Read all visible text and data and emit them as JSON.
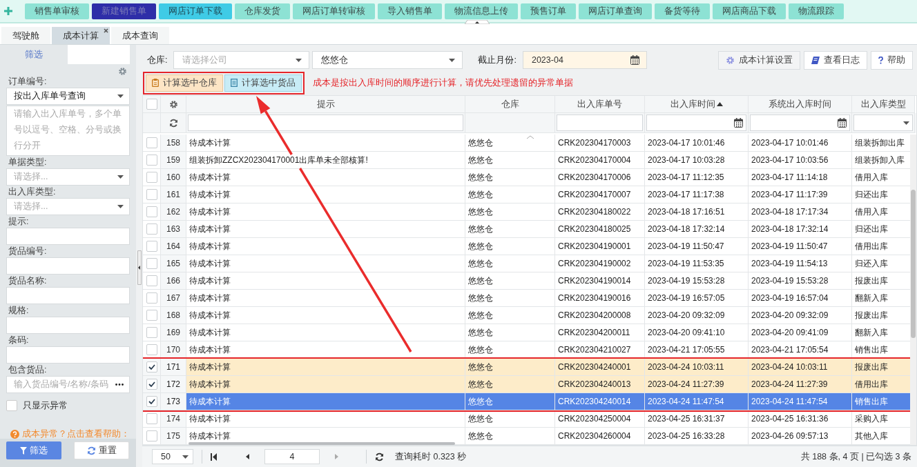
{
  "nav_buttons": [
    {
      "label": "销售单审核",
      "kind": "normal"
    },
    {
      "label": "新建销售单",
      "kind": "dark"
    },
    {
      "label": "网店订单下载",
      "kind": "active"
    },
    {
      "label": "仓库发货",
      "kind": "normal"
    },
    {
      "label": "网店订单转审核",
      "kind": "normal"
    },
    {
      "label": "导入销售单",
      "kind": "normal"
    },
    {
      "label": "物流信息上传",
      "kind": "normal"
    },
    {
      "label": "预售订单",
      "kind": "normal"
    },
    {
      "label": "网店订单查询",
      "kind": "normal"
    },
    {
      "label": "备货等待",
      "kind": "normal"
    },
    {
      "label": "网店商品下载",
      "kind": "normal"
    },
    {
      "label": "物流跟踪",
      "kind": "normal"
    }
  ],
  "tabs": [
    {
      "label": "驾驶舱",
      "selected": false,
      "closable": false
    },
    {
      "label": "成本计算",
      "selected": true,
      "closable": true
    },
    {
      "label": "成本查询",
      "selected": false,
      "closable": false
    }
  ],
  "sidebar": {
    "tab": "筛选",
    "fields": [
      {
        "label": "订单编号:",
        "kind": "select",
        "value": "按出入库单号查询"
      },
      {
        "kind": "textarea",
        "placeholder": "请输入出入库单号，多个单号以逗号、空格、分号或换行分开"
      },
      {
        "label": "单据类型:",
        "kind": "select",
        "placeholder": "请选择..."
      },
      {
        "label": "出入库类型:",
        "kind": "select",
        "placeholder": "请选择..."
      },
      {
        "label": "提示:",
        "kind": "text"
      },
      {
        "label": "货品编号:",
        "kind": "text"
      },
      {
        "label": "货品名称:",
        "kind": "text"
      },
      {
        "label": "规格:",
        "kind": "text"
      },
      {
        "label": "条码:",
        "kind": "text"
      },
      {
        "label": "包含货品:",
        "kind": "picker",
        "placeholder": "输入货品编号/名称/条码"
      }
    ],
    "only_abnormal": {
      "label": "只显示异常",
      "checked": false
    },
    "help_link": "成本异常？点击查看帮助：",
    "buttons": [
      {
        "label": "筛选",
        "kind": "primary"
      },
      {
        "label": "重置",
        "kind": "default"
      }
    ]
  },
  "toolbar": {
    "warehouse_label": "仓库:",
    "company_placeholder": "请选择公司",
    "warehouse_value": "悠悠仓",
    "month_label": "截止月份:",
    "month_value": "2023-04",
    "right_buttons": [
      {
        "label": "成本计算设置",
        "kind": "settings"
      },
      {
        "label": "查看日志",
        "kind": "log"
      },
      {
        "label": "帮助",
        "kind": "help"
      }
    ],
    "actions": [
      {
        "label": "计算选中仓库",
        "kind": "warehouse"
      },
      {
        "label": "计算选中货品",
        "kind": "goods"
      }
    ],
    "notice": "成本是按出入库时间的顺序进行计算，请优先处理遗留的异常单据"
  },
  "table": {
    "all_checked": false,
    "columns": [
      {
        "label": "提示",
        "kind": "text",
        "sorted": false
      },
      {
        "label": "仓库",
        "kind": "none",
        "sorted": false
      },
      {
        "label": "出入库单号",
        "kind": "text",
        "sorted": false
      },
      {
        "label": "出入库时间",
        "kind": "date",
        "sorted": true
      },
      {
        "label": "系统出入库时间",
        "kind": "date",
        "sorted": false
      },
      {
        "label": "出入库类型",
        "kind": "select",
        "sorted": false
      }
    ],
    "rows": [
      {
        "no": "158",
        "hint": "待成本计算",
        "warehouse": "悠悠仓",
        "order_no": "CRK202304170003",
        "time": "2023-04-17 10:01:46",
        "sys_time": "2023-04-17 10:01:46",
        "type": "组装拆卸出库",
        "checked": false,
        "selected": false
      },
      {
        "no": "159",
        "hint": "组装拆卸ZZCX202304170001出库单未全部核算!",
        "warehouse": "悠悠仓",
        "order_no": "CRK202304170004",
        "time": "2023-04-17 10:03:28",
        "sys_time": "2023-04-17 10:03:56",
        "type": "组装拆卸入库",
        "checked": false,
        "selected": false
      },
      {
        "no": "160",
        "hint": "待成本计算",
        "warehouse": "悠悠仓",
        "order_no": "CRK202304170006",
        "time": "2023-04-17 11:12:35",
        "sys_time": "2023-04-17 11:14:18",
        "type": "借用入库",
        "checked": false,
        "selected": false
      },
      {
        "no": "161",
        "hint": "待成本计算",
        "warehouse": "悠悠仓",
        "order_no": "CRK202304170007",
        "time": "2023-04-17 11:17:38",
        "sys_time": "2023-04-17 11:17:39",
        "type": "归还出库",
        "checked": false,
        "selected": false
      },
      {
        "no": "162",
        "hint": "待成本计算",
        "warehouse": "悠悠仓",
        "order_no": "CRK202304180022",
        "time": "2023-04-18 17:16:51",
        "sys_time": "2023-04-18 17:17:34",
        "type": "借用入库",
        "checked": false,
        "selected": false
      },
      {
        "no": "163",
        "hint": "待成本计算",
        "warehouse": "悠悠仓",
        "order_no": "CRK202304180025",
        "time": "2023-04-18 17:32:14",
        "sys_time": "2023-04-18 17:32:14",
        "type": "归还出库",
        "checked": false,
        "selected": false
      },
      {
        "no": "164",
        "hint": "待成本计算",
        "warehouse": "悠悠仓",
        "order_no": "CRK202304190001",
        "time": "2023-04-19 11:50:47",
        "sys_time": "2023-04-19 11:50:47",
        "type": "借用出库",
        "checked": false,
        "selected": false
      },
      {
        "no": "165",
        "hint": "待成本计算",
        "warehouse": "悠悠仓",
        "order_no": "CRK202304190002",
        "time": "2023-04-19 11:53:35",
        "sys_time": "2023-04-19 11:54:13",
        "type": "归还入库",
        "checked": false,
        "selected": false
      },
      {
        "no": "166",
        "hint": "待成本计算",
        "warehouse": "悠悠仓",
        "order_no": "CRK202304190014",
        "time": "2023-04-19 15:53:28",
        "sys_time": "2023-04-19 15:53:28",
        "type": "报废出库",
        "checked": false,
        "selected": false
      },
      {
        "no": "167",
        "hint": "待成本计算",
        "warehouse": "悠悠仓",
        "order_no": "CRK202304190016",
        "time": "2023-04-19 16:57:05",
        "sys_time": "2023-04-19 16:57:04",
        "type": "翻新入库",
        "checked": false,
        "selected": false
      },
      {
        "no": "168",
        "hint": "待成本计算",
        "warehouse": "悠悠仓",
        "order_no": "CRK202304200008",
        "time": "2023-04-20 09:32:09",
        "sys_time": "2023-04-20 09:32:09",
        "type": "报废出库",
        "checked": false,
        "selected": false
      },
      {
        "no": "169",
        "hint": "待成本计算",
        "warehouse": "悠悠仓",
        "order_no": "CRK202304200011",
        "time": "2023-04-20 09:41:10",
        "sys_time": "2023-04-20 09:41:09",
        "type": "翻新入库",
        "checked": false,
        "selected": false
      },
      {
        "no": "170",
        "hint": "待成本计算",
        "warehouse": "悠悠仓",
        "order_no": "CRK202304210027",
        "time": "2023-04-21 17:05:55",
        "sys_time": "2023-04-21 17:05:54",
        "type": "销售出库",
        "checked": false,
        "selected": false
      },
      {
        "no": "171",
        "hint": "待成本计算",
        "warehouse": "悠悠仓",
        "order_no": "CRK202304240001",
        "time": "2023-04-24 10:03:11",
        "sys_time": "2023-04-24 10:03:11",
        "type": "报废出库",
        "checked": true,
        "selected": false
      },
      {
        "no": "172",
        "hint": "待成本计算",
        "warehouse": "悠悠仓",
        "order_no": "CRK202304240013",
        "time": "2023-04-24 11:27:39",
        "sys_time": "2023-04-24 11:27:39",
        "type": "借用出库",
        "checked": true,
        "selected": false
      },
      {
        "no": "173",
        "hint": "待成本计算",
        "warehouse": "悠悠仓",
        "order_no": "CRK202304240014",
        "time": "2023-04-24 11:47:54",
        "sys_time": "2023-04-24 11:47:54",
        "type": "销售出库",
        "checked": true,
        "selected": true
      },
      {
        "no": "174",
        "hint": "待成本计算",
        "warehouse": "悠悠仓",
        "order_no": "CRK202304250004",
        "time": "2023-04-25 16:31:37",
        "sys_time": "2023-04-25 16:31:36",
        "type": "采购入库",
        "checked": false,
        "selected": false
      },
      {
        "no": "175",
        "hint": "待成本计算",
        "warehouse": "悠悠仓",
        "order_no": "CRK202304260004",
        "time": "2023-04-25 16:33:28",
        "sys_time": "2023-04-26 09:57:13",
        "type": "其他入库",
        "checked": false,
        "selected": false
      }
    ]
  },
  "pager": {
    "page_size": "50",
    "page": "4",
    "elapsed": "查询耗时 0.323 秒",
    "summary": "共 188 条, 4 页 | 已勾选 3 条"
  }
}
